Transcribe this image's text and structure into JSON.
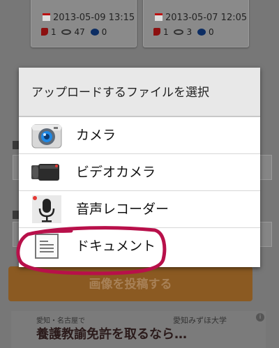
{
  "background": {
    "cards": [
      {
        "date": "2013-05-09 13:15",
        "likes": "1",
        "views": "47",
        "comments": "0"
      },
      {
        "date": "2013-05-07 12:05",
        "likes": "1",
        "views": "3",
        "comments": "0"
      }
    ],
    "submit_label": "画像を投稿する",
    "banner": {
      "line1": "愛知・名古屋で",
      "line2": "養護教諭免許を取るなら…",
      "brand": "愛知みずほ大学",
      "info": "i"
    }
  },
  "dialog": {
    "title": "アップロードするファイルを選択",
    "items": [
      {
        "label": "カメラ",
        "icon": "camera-icon"
      },
      {
        "label": "ビデオカメラ",
        "icon": "video-camera-icon"
      },
      {
        "label": "音声レコーダー",
        "icon": "microphone-icon"
      },
      {
        "label": "ドキュメント",
        "icon": "document-icon"
      }
    ]
  },
  "colors": {
    "highlight_marker": "#b8104a",
    "dialog_title_bg": "#e8e8e8"
  }
}
